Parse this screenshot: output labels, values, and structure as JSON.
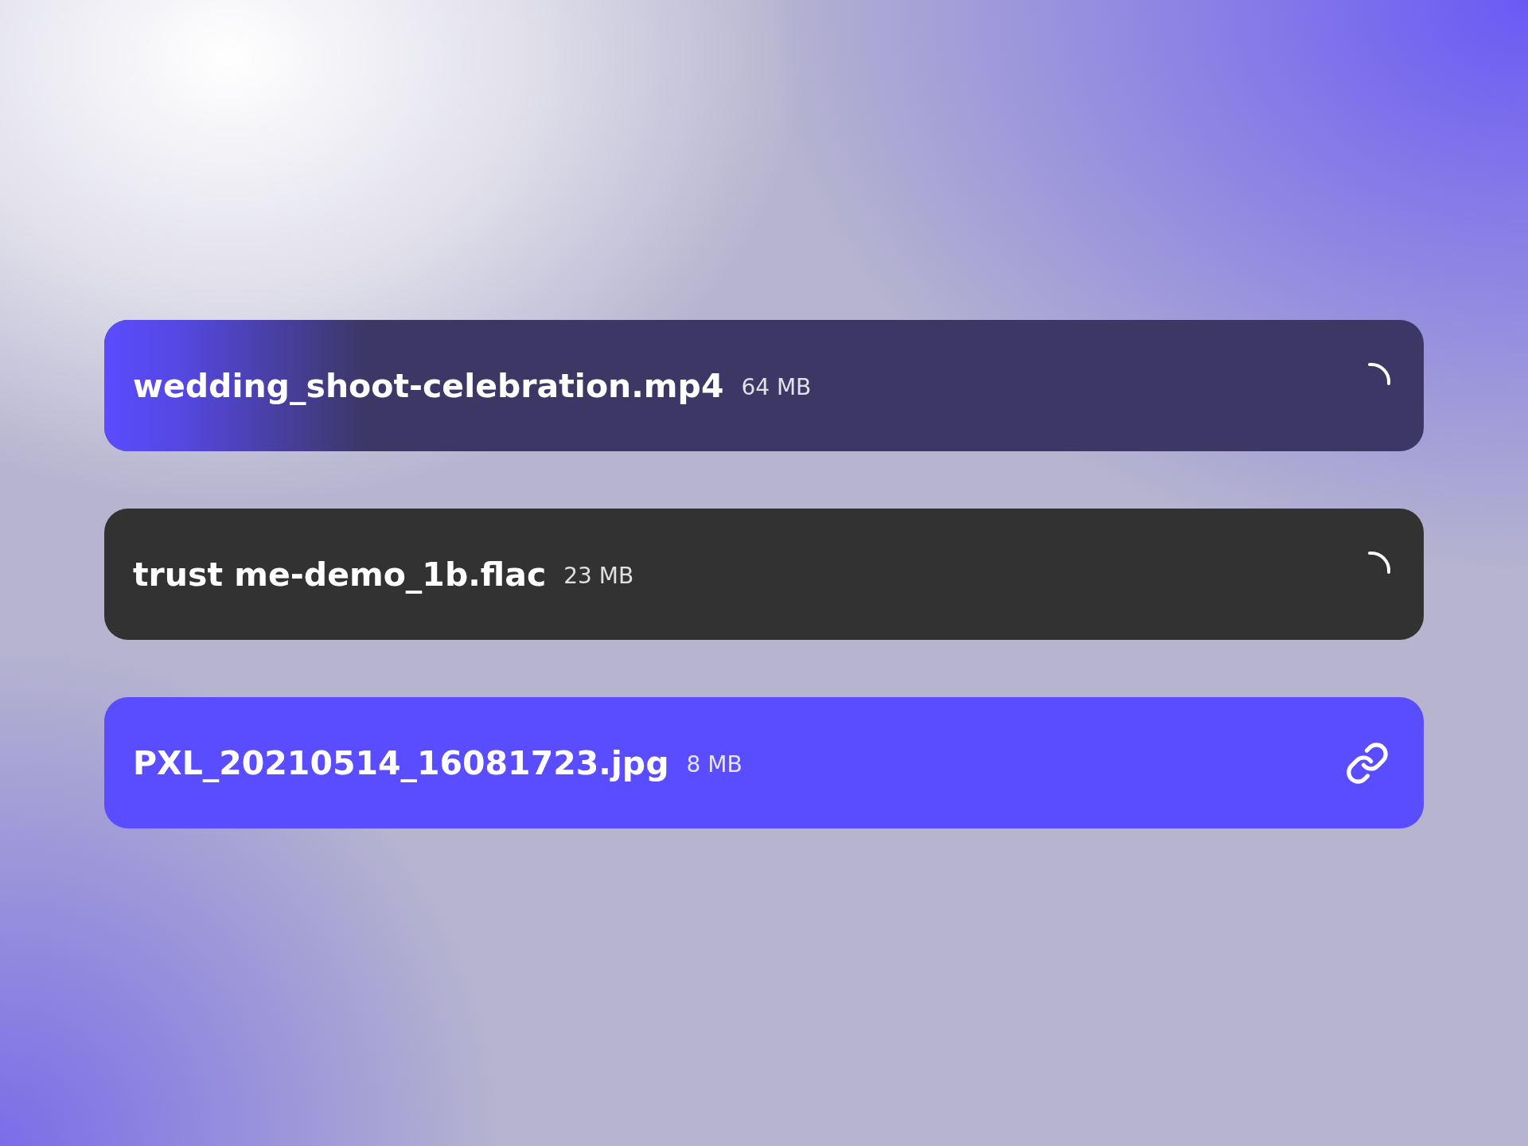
{
  "files": [
    {
      "name": "wedding_shoot-celebration.mp4",
      "size": "64 MB",
      "kind": "uploading",
      "level": 0.2
    },
    {
      "name": "trust me-demo_1b.flac",
      "size": "23 MB",
      "kind": "uploading"
    },
    {
      "name": "PXL_20210514_16081723.jpg",
      "size": "8 MB",
      "kind": "done"
    }
  ]
}
